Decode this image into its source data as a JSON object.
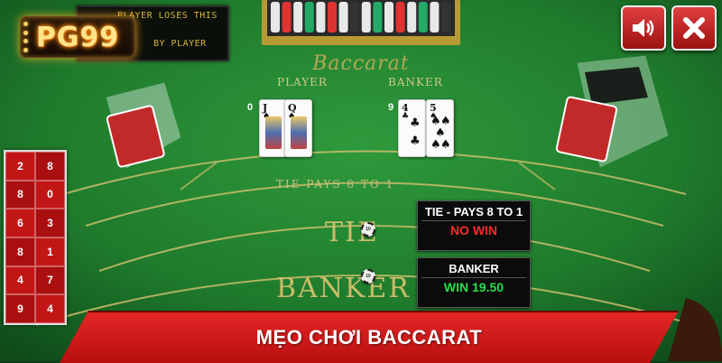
{
  "scoreboard": {
    "line1": "PLAYER LOSES THIS",
    "line2": "BY PLAYER"
  },
  "logo": {
    "text": "PG99"
  },
  "controls": {
    "sound_icon": "speaker-icon",
    "close_icon": "close-icon",
    "close_label": "X"
  },
  "table": {
    "title": "Baccarat",
    "player_label": "PLAYER",
    "banker_label": "BANKER",
    "tie_pays": "TIE PAYS 8 TO 1",
    "tie_area": "TIE",
    "banker_area": "BANKER"
  },
  "hands": {
    "player": {
      "score": "0",
      "cards": [
        {
          "rank": "J",
          "suit": "♠"
        },
        {
          "rank": "Q",
          "suit": "♠"
        }
      ]
    },
    "banker": {
      "score": "9",
      "cards": [
        {
          "rank": "4",
          "suit": "♣"
        },
        {
          "rank": "5",
          "suit": "♠"
        }
      ]
    }
  },
  "results": {
    "tie": {
      "title": "TIE - PAYS 8 TO 1",
      "status": "NO WIN",
      "status_color": "#ff2a2a"
    },
    "banker": {
      "title": "BANKER",
      "status": "WIN 19.50",
      "status_color": "#22e04a"
    }
  },
  "chips": {
    "tie": "10",
    "banker": "10"
  },
  "roadmap": [
    [
      "2",
      "8"
    ],
    [
      "8",
      "0"
    ],
    [
      "6",
      "3"
    ],
    [
      "8",
      "1"
    ],
    [
      "4",
      "7"
    ],
    [
      "9",
      "4"
    ]
  ],
  "banner": {
    "text": "MẸO CHƠI BACCARAT"
  },
  "colors": {
    "felt": "#1e7a2c",
    "banner_red": "#d81c1c",
    "gold_text": "#c9bd6a",
    "win_green": "#22e04a",
    "lose_red": "#ff2a2a"
  }
}
